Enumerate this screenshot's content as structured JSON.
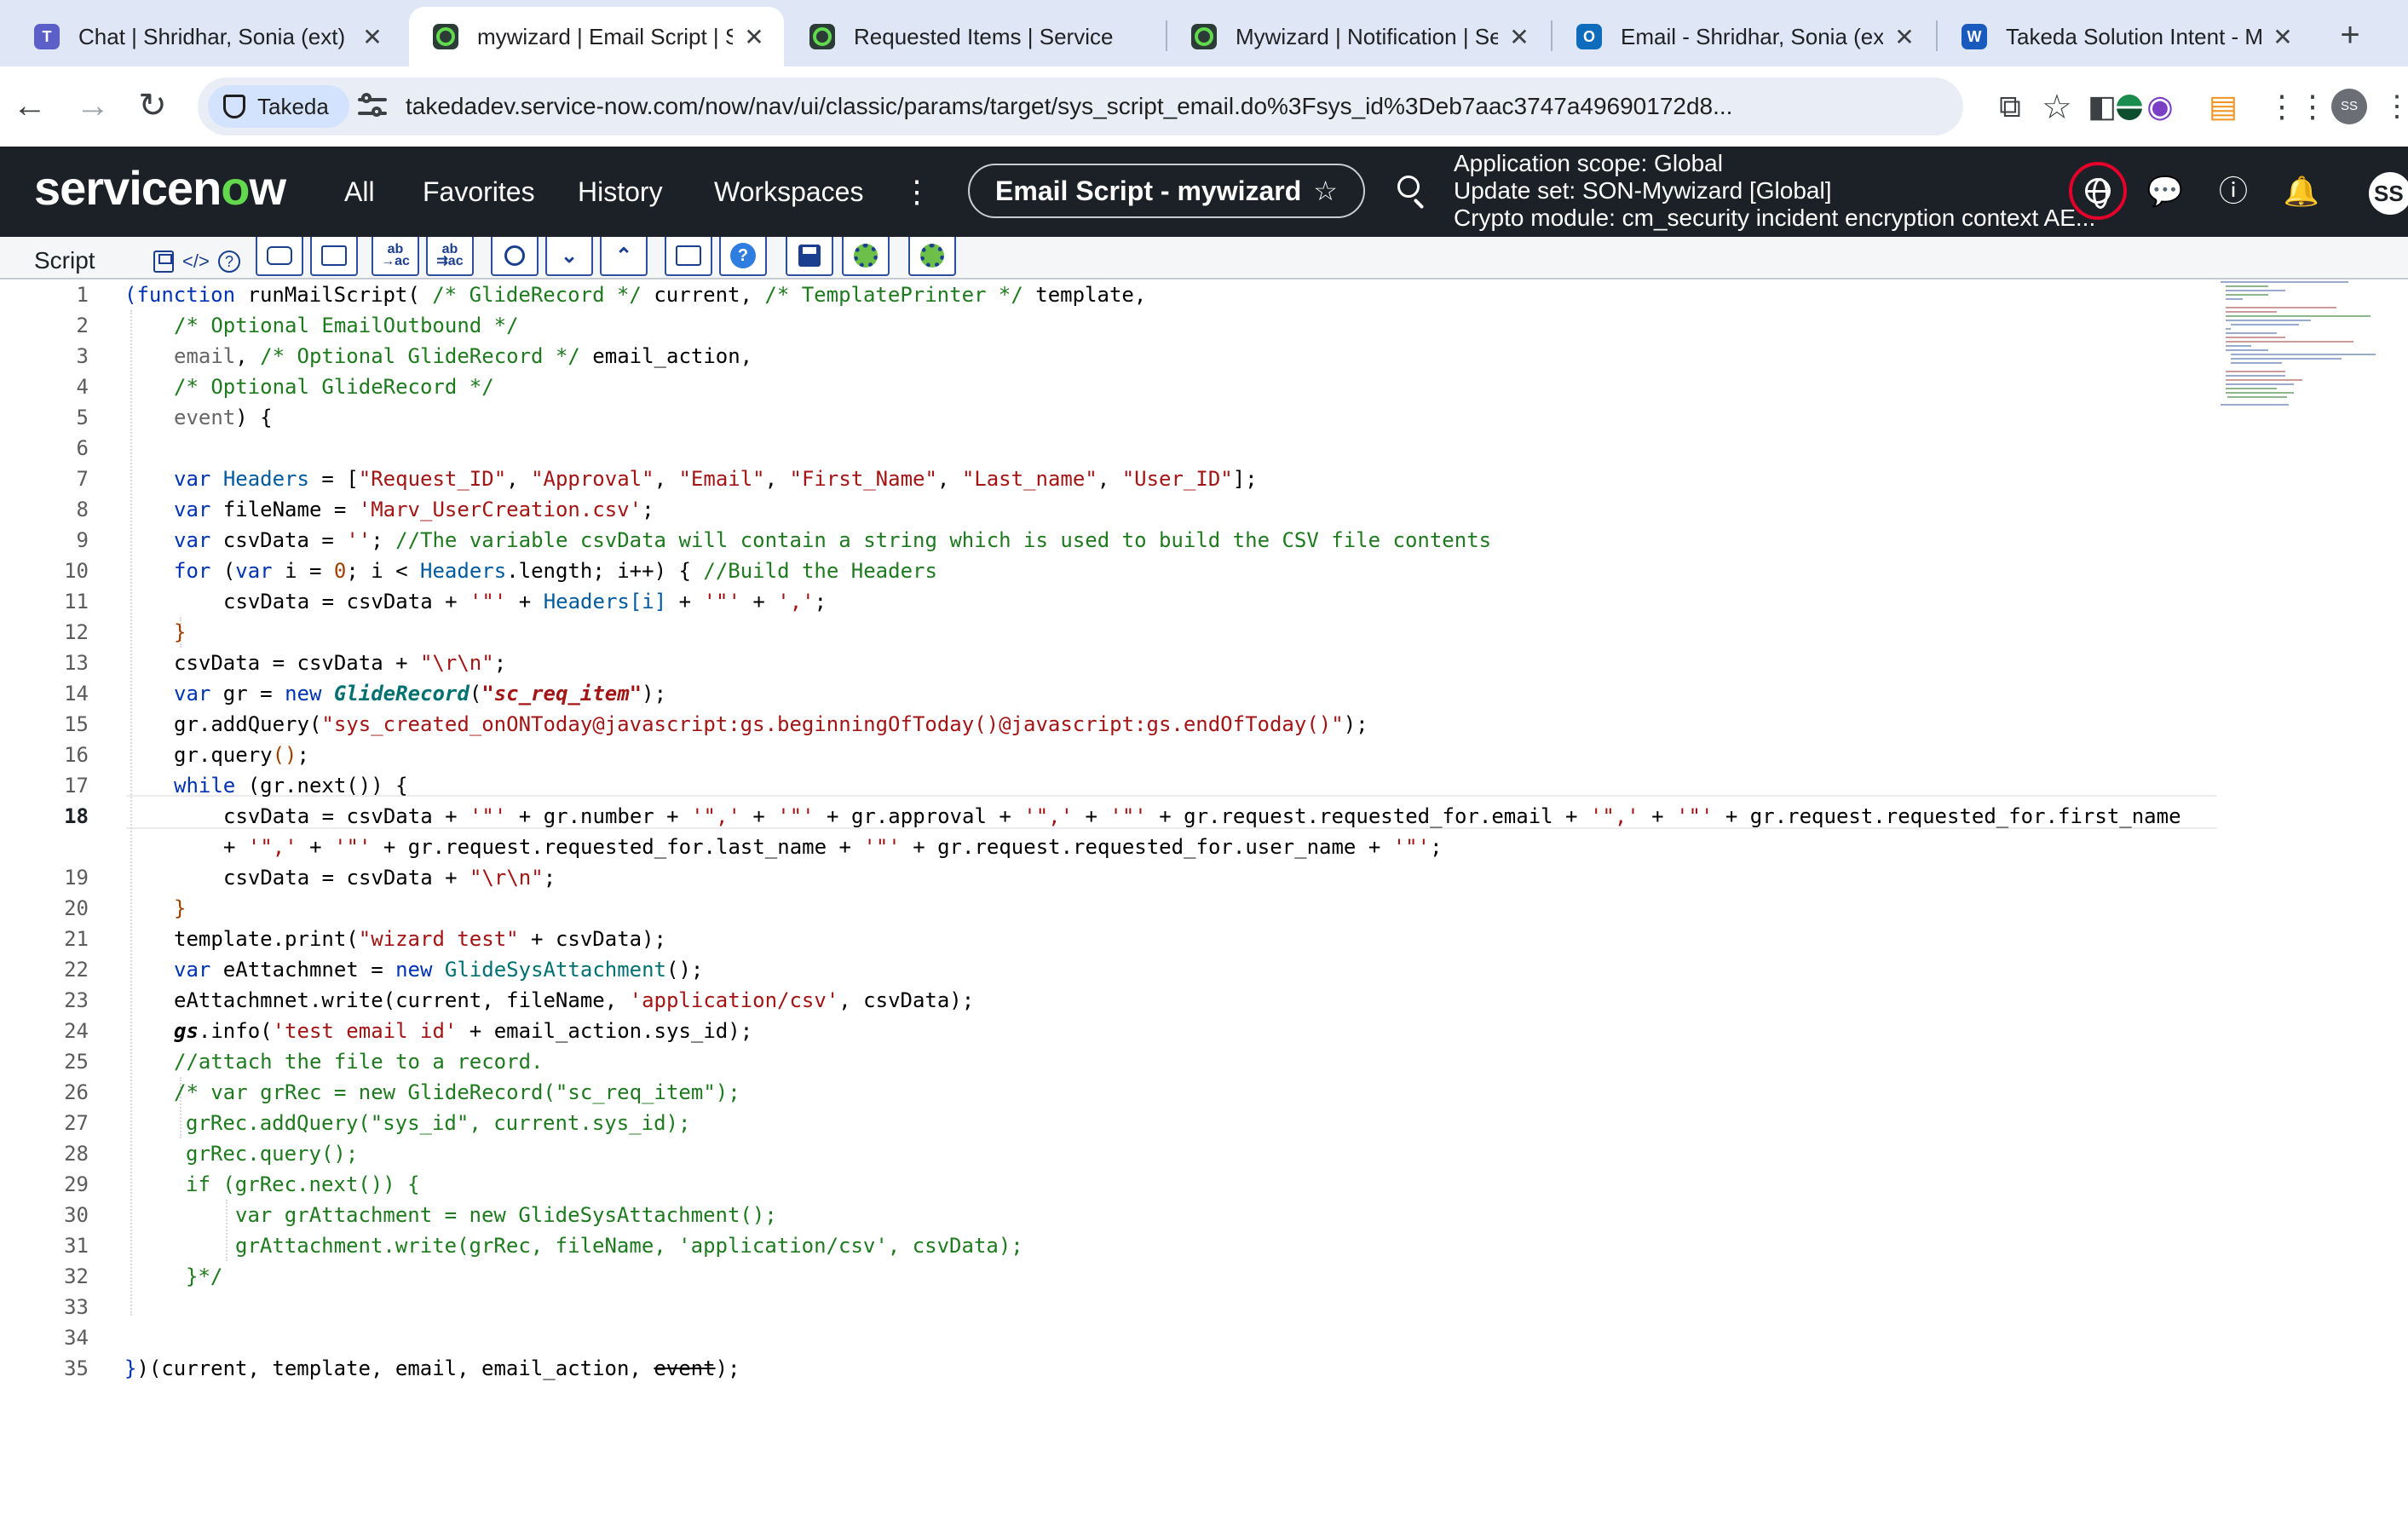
{
  "browser": {
    "tabs": [
      {
        "label": "Chat | Shridhar, Sonia (ext)",
        "icon": "teams-icon",
        "active": false
      },
      {
        "label": "mywizard | Email Script | ServiceNow",
        "icon": "servicenow-icon",
        "active": true
      },
      {
        "label": "Requested Items | ServiceNow",
        "icon": "servicenow-icon",
        "active": false
      },
      {
        "label": "Mywizard | Notification | ServiceNow",
        "icon": "servicenow-icon",
        "active": false
      },
      {
        "label": "Email - Shridhar, Sonia (ext)",
        "icon": "outlook-icon",
        "active": false
      },
      {
        "label": "Takeda Solution Intent - My",
        "icon": "word-icon",
        "active": false
      }
    ],
    "site_chip": "Takeda",
    "url": "takedadev.service-now.com/now/nav/ui/classic/params/target/sys_script_email.do%3Fsys_id%3Deb7aac3747a49690172d8...",
    "profile_initials": "SS"
  },
  "header": {
    "logo_prefix": "servicen",
    "logo_o": "o",
    "logo_suffix": "w",
    "nav": [
      "All",
      "Favorites",
      "History",
      "Workspaces"
    ],
    "pill_title": "Email Script - mywizard",
    "scope_line1": "Application scope: Global",
    "scope_line2": "Update set: SON-Mywizard [Global]",
    "scope_line3": "Crypto module: cm_security incident encryption context AE...",
    "avatar_initials": "SS",
    "accent_color": "#62d84e",
    "alert_ring_color": "#e4002b"
  },
  "editor": {
    "field_label": "Script",
    "current_line": 18,
    "line_numbers": [
      "1",
      "2",
      "3",
      "4",
      "5",
      "6",
      "7",
      "8",
      "9",
      "10",
      "11",
      "12",
      "13",
      "14",
      "15",
      "16",
      "17",
      "18",
      "19",
      "20",
      "21",
      "22",
      "23",
      "24",
      "25",
      "26",
      "27",
      "28",
      "29",
      "30",
      "31",
      "32",
      "33",
      "34",
      "35"
    ],
    "toolbar_buttons": [
      "toggle-comment",
      "format-code",
      "replace",
      "replace-all",
      "search",
      "find-next",
      "find-previous",
      "fullscreen",
      "help",
      "save",
      "script-debugger",
      "script-tracer"
    ],
    "code": {
      "l1": [
        "(",
        "function",
        " runMailScript( ",
        "/* GlideRecord */",
        " current, ",
        "/* TemplatePrinter */",
        " template,"
      ],
      "l2": [
        "/* Optional EmailOutbound */"
      ],
      "l3": [
        "email",
        ", ",
        "/* Optional GlideRecord */",
        " email_action,"
      ],
      "l4": [
        "/* Optional GlideRecord */"
      ],
      "l5": [
        "event",
        ") {"
      ],
      "l7": [
        "var",
        " ",
        "Headers",
        " = [",
        "\"Request_ID\"",
        ", ",
        "\"Approval\"",
        ", ",
        "\"Email\"",
        ", ",
        "\"First_Name\"",
        ", ",
        "\"Last_name\"",
        ", ",
        "\"User_ID\"",
        "];"
      ],
      "l8": [
        "var",
        " fileName = ",
        "'Marv_UserCreation.csv'",
        ";"
      ],
      "l9": [
        "var",
        " csvData = ",
        "''",
        "; ",
        "//The variable csvData will contain a string which is used to build the CSV file contents"
      ],
      "l10": [
        "for",
        " (",
        "var",
        " i = ",
        "0",
        "; i < ",
        "Headers",
        ".length; i++) { ",
        "//Build the Headers"
      ],
      "l11": [
        "csvData = csvData + ",
        "'\"'",
        " + ",
        "Headers[i]",
        " + ",
        "'\"'",
        " + ",
        "','",
        ";"
      ],
      "l12": [
        "}"
      ],
      "l13": [
        "csvData = csvData + ",
        "\"\\r\\n\"",
        ";"
      ],
      "l14": [
        "var",
        " gr = ",
        "new",
        " ",
        "GlideRecord",
        "(",
        "\"sc_req_item\"",
        ");"
      ],
      "l15": [
        "gr.addQuery(",
        "\"sys_created_onONToday@javascript:gs.beginningOfToday()@javascript:gs.endOfToday()\"",
        ");"
      ],
      "l16": [
        "gr.query",
        "()",
        ";"
      ],
      "l17": [
        "while",
        " (gr.next()) {"
      ],
      "l18a": [
        "csvData = csvData + ",
        "'\"'",
        " + gr.number + ",
        "'\",'",
        " + ",
        "'\"'",
        " + gr.approval + ",
        "'\",'",
        " + ",
        "'\"'",
        " + gr.request.requested_for.email + ",
        "'\",'",
        " + ",
        "'\"'",
        " + gr.request.requested_for.first_name"
      ],
      "l18b": [
        "+ ",
        "'\",'",
        " + ",
        "'\"'",
        " + gr.request.requested_for.last_name + ",
        "'\"'",
        " + gr.request.requested_for.user_name + ",
        "'\"'",
        ";"
      ],
      "l19": [
        "csvData = csvData + ",
        "\"\\r\\n\"",
        ";"
      ],
      "l20": [
        "}"
      ],
      "l21": [
        "template.print(",
        "\"wizard test\"",
        " + csvData);"
      ],
      "l22": [
        "var",
        " eAttachmnet = ",
        "new",
        " ",
        "GlideSysAttachment",
        "();"
      ],
      "l23": [
        "eAttachmnet.write(current, fileName, ",
        "'application/csv'",
        ", csvData);"
      ],
      "l24": [
        "gs",
        ".info(",
        "'test email id'",
        " + email_action.sys_id);"
      ],
      "l25": [
        "//attach the file to a record."
      ],
      "l26": [
        "/* var grRec = new GlideRecord(\"sc_req_item\");"
      ],
      "l27": [
        "grRec.addQuery(\"sys_id\", current.sys_id);"
      ],
      "l28": [
        "grRec.query();"
      ],
      "l29": [
        "if (grRec.next()) {"
      ],
      "l30": [
        "var grAttachment = new GlideSysAttachment();"
      ],
      "l31": [
        "grAttachment.write(grRec, fileName, 'application/csv', csvData);"
      ],
      "l32": [
        "}*/"
      ],
      "l35": [
        "}",
        ")(current, template, email, email_action, ",
        "event",
        ");"
      ]
    }
  }
}
